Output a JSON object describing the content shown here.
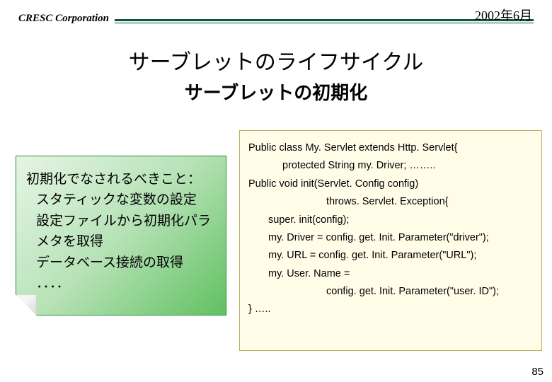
{
  "header": {
    "corporation": "CRESC Corporation",
    "date": "2002年6月"
  },
  "title": {
    "main": "サーブレットのライフサイクル",
    "sub": "サーブレットの初期化"
  },
  "left": {
    "heading": "初期化でなされるべきこと：",
    "item1": "スタティックな変数の設定",
    "item2": "設定ファイルから初期化パラメタを取得",
    "item3": "データベース接続の取得",
    "ellipsis": "．．．．"
  },
  "code": {
    "l1": "Public class My. Servlet extends Http. Servlet{",
    "l2": "protected String my. Driver; ……..",
    "l3": "Public void init(Servlet. Config config)",
    "l4": "throws. Servlet. Exception{",
    "l5": "super. init(config);",
    "l6": "my. Driver = config. get. Init. Parameter(\"driver\");",
    "l7": "my. URL = config. get. Init. Parameter(\"URL\");",
    "l8": "my. User. Name =",
    "l9": "config. get. Init. Parameter(\"user. ID\");",
    "l10": "} ….."
  },
  "page": "85"
}
